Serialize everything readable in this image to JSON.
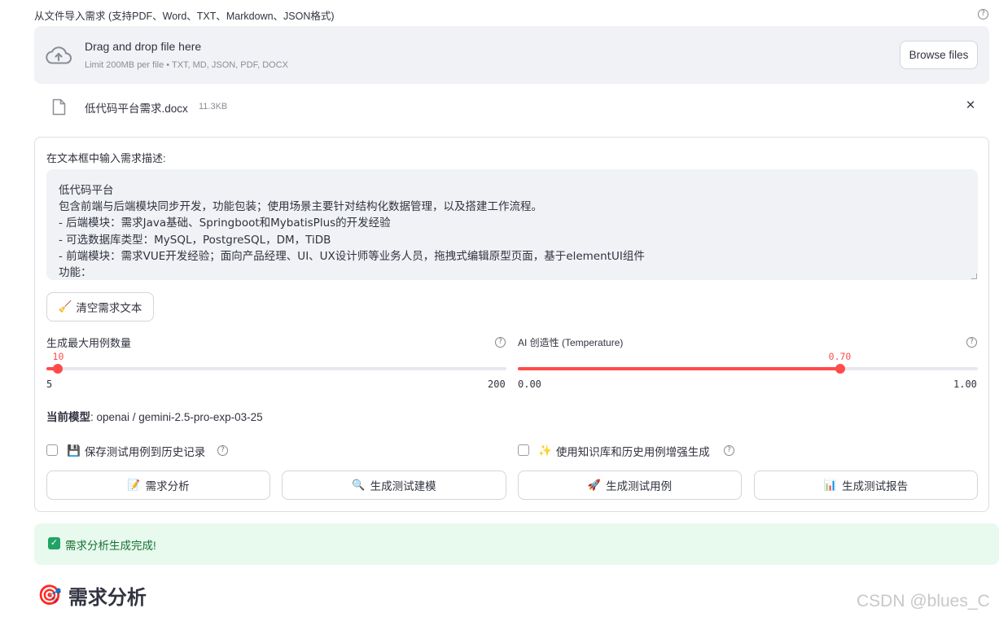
{
  "uploader": {
    "label": "从文件导入需求 (支持PDF、Word、TXT、Markdown、JSON格式)",
    "drop_title": "Drag and drop file here",
    "drop_sub": "Limit 200MB per file • TXT, MD, JSON, PDF, DOCX",
    "browse_label": "Browse files",
    "file_name": "低代码平台需求.docx",
    "file_size": "11.3KB",
    "help_glyph": "?",
    "close_glyph": "×"
  },
  "requirement": {
    "label": "在文本框中输入需求描述:",
    "text": "低代码平台\n包含前端与后端模块同步开发，功能包装；使用场景主要针对结构化数据管理，以及搭建工作流程。\n- 后端模块：需求Java基础、Springboot和MybatisPlus的开发经验\n- 可选数据库类型：MySQL，PostgreSQL，DM，TiDB\n- 前端模块：需求VUE开发经验；面向产品经理、UI、UX设计师等业务人员，拖拽式编辑原型页面，基于elementUI组件\n功能：",
    "clear_icon": "🧹",
    "clear_label": "清空需求文本"
  },
  "slider_max_cases": {
    "label": "生成最大用例数量",
    "value": 10,
    "value_text": "10",
    "min": 5,
    "max": 200,
    "min_text": "5",
    "max_text": "200"
  },
  "slider_temperature": {
    "label": "AI 创造性 (Temperature)",
    "value": 0.7,
    "value_text": "0.70",
    "min": 0,
    "max": 1,
    "min_text": "0.00",
    "max_text": "1.00"
  },
  "model": {
    "label": "当前模型",
    "value": ": openai / gemini-2.5-pro-exp-03-25"
  },
  "checkboxes": [
    {
      "icon": "💾",
      "label": "保存测试用例到历史记录",
      "checked": false
    },
    {
      "icon": "✨",
      "label": "使用知识库和历史用例增强生成",
      "checked": false
    }
  ],
  "actions": [
    {
      "icon": "📝",
      "label": "需求分析"
    },
    {
      "icon": "🔍",
      "label": "生成测试建模"
    },
    {
      "icon": "🚀",
      "label": "生成测试用例"
    },
    {
      "icon": "📊",
      "label": "生成测试报告"
    }
  ],
  "status": {
    "check_glyph": "✓",
    "message": "需求分析生成完成!"
  },
  "section": {
    "icon": "🎯",
    "title": "需求分析"
  },
  "watermark": "CSDN @blues_C",
  "colors": {
    "accent": "#ff4b4b",
    "success_bg": "#e8f9ee",
    "success_text": "#177233",
    "panel_bg": "#f0f2f6"
  }
}
